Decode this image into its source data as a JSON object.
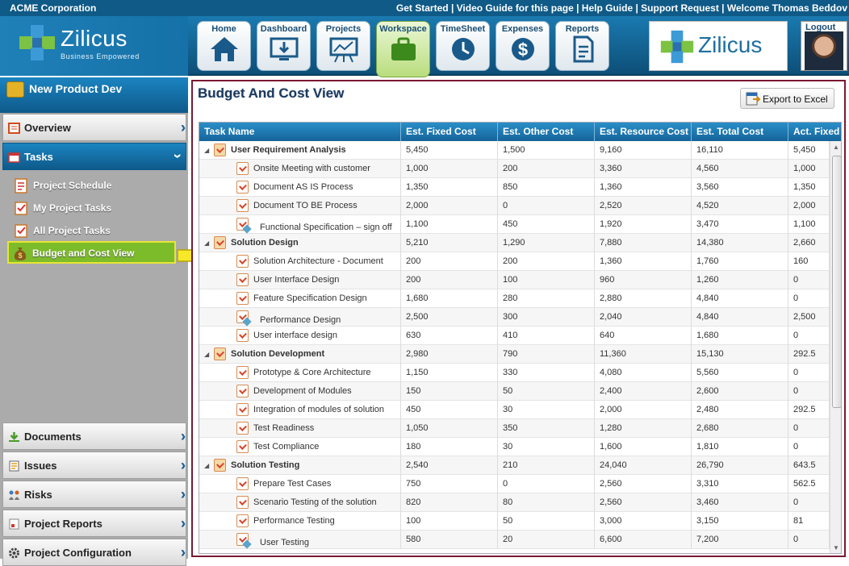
{
  "topbar": {
    "company": "ACME Corporation",
    "links": "Get Started | Video Guide for this page | Help Guide | Support Request | Welcome Thomas Beddov"
  },
  "logo": {
    "name": "Zilicus",
    "tagline": "Business Empowered"
  },
  "nav": [
    {
      "label": "Home",
      "icon": "home-icon"
    },
    {
      "label": "Dashboard",
      "icon": "dashboard-icon"
    },
    {
      "label": "Projects",
      "icon": "projects-icon"
    },
    {
      "label": "Workspace",
      "icon": "briefcase-icon",
      "active": true
    },
    {
      "label": "TimeSheet",
      "icon": "clock-icon"
    },
    {
      "label": "Expenses",
      "icon": "dollar-icon"
    },
    {
      "label": "Reports",
      "icon": "report-icon"
    }
  ],
  "brand": {
    "name": "Zilicus"
  },
  "logout": {
    "label": "Logout"
  },
  "sidebar": {
    "project": "New Product Dev",
    "overview": "Overview",
    "tasks": "Tasks",
    "sub_items": [
      "Project Schedule",
      "My Project Tasks",
      "All Project Tasks",
      "Budget and Cost View"
    ],
    "documents": "Documents",
    "issues": "Issues",
    "risks": "Risks",
    "reports": "Project Reports",
    "config": "Project Configuration"
  },
  "page": {
    "title": "Budget And Cost View",
    "export": "Export to Excel"
  },
  "grid": {
    "columns": [
      "Task Name",
      "Est. Fixed Cost",
      "Est. Other Cost",
      "Est. Resource Cost",
      "Est. Total Cost",
      "Act. Fixed Cost"
    ],
    "rows": [
      {
        "name": "User Requirement Analysis",
        "level": 0,
        "type": "group",
        "c": [
          "5,450",
          "1,500",
          "9,160",
          "16,110",
          "5,450"
        ]
      },
      {
        "name": "Onsite Meeting with customer",
        "level": 1,
        "type": "task",
        "c": [
          "1,000",
          "200",
          "3,360",
          "4,560",
          "1,000"
        ]
      },
      {
        "name": "Document AS IS Process",
        "level": 1,
        "type": "task",
        "c": [
          "1,350",
          "850",
          "1,360",
          "3,560",
          "1,350"
        ]
      },
      {
        "name": "Document TO BE Process",
        "level": 1,
        "type": "task",
        "c": [
          "2,000",
          "0",
          "2,520",
          "4,520",
          "2,000"
        ]
      },
      {
        "name": "Functional Specification – sign off",
        "level": 1,
        "type": "milestone",
        "c": [
          "1,100",
          "450",
          "1,920",
          "3,470",
          "1,100"
        ]
      },
      {
        "name": "Solution Design",
        "level": 0,
        "type": "group",
        "c": [
          "5,210",
          "1,290",
          "7,880",
          "14,380",
          "2,660"
        ]
      },
      {
        "name": "Solution Architecture - Document",
        "level": 1,
        "type": "task",
        "c": [
          "200",
          "200",
          "1,360",
          "1,760",
          "160"
        ]
      },
      {
        "name": "User Interface Design",
        "level": 1,
        "type": "task",
        "c": [
          "200",
          "100",
          "960",
          "1,260",
          "0"
        ]
      },
      {
        "name": "Feature Specification Design",
        "level": 1,
        "type": "task",
        "c": [
          "1,680",
          "280",
          "2,880",
          "4,840",
          "0"
        ]
      },
      {
        "name": "Performance Design",
        "level": 1,
        "type": "milestone",
        "c": [
          "2,500",
          "300",
          "2,040",
          "4,840",
          "2,500"
        ]
      },
      {
        "name": "User interface design",
        "level": 1,
        "type": "task",
        "c": [
          "630",
          "410",
          "640",
          "1,680",
          "0"
        ]
      },
      {
        "name": "Solution Development",
        "level": 0,
        "type": "group",
        "c": [
          "2,980",
          "790",
          "11,360",
          "15,130",
          "292.5"
        ]
      },
      {
        "name": "Prototype & Core Architecture",
        "level": 1,
        "type": "task",
        "c": [
          "1,150",
          "330",
          "4,080",
          "5,560",
          "0"
        ]
      },
      {
        "name": "Development of Modules",
        "level": 1,
        "type": "task",
        "c": [
          "150",
          "50",
          "2,400",
          "2,600",
          "0"
        ]
      },
      {
        "name": "Integration of modules of solution",
        "level": 1,
        "type": "task",
        "c": [
          "450",
          "30",
          "2,000",
          "2,480",
          "292.5"
        ]
      },
      {
        "name": "Test Readiness",
        "level": 1,
        "type": "task",
        "c": [
          "1,050",
          "350",
          "1,280",
          "2,680",
          "0"
        ]
      },
      {
        "name": "Test Compliance",
        "level": 1,
        "type": "task",
        "c": [
          "180",
          "30",
          "1,600",
          "1,810",
          "0"
        ]
      },
      {
        "name": "Solution Testing",
        "level": 0,
        "type": "group",
        "c": [
          "2,540",
          "210",
          "24,040",
          "26,790",
          "643.5"
        ]
      },
      {
        "name": "Prepare Test Cases",
        "level": 1,
        "type": "task",
        "c": [
          "750",
          "0",
          "2,560",
          "3,310",
          "562.5"
        ]
      },
      {
        "name": "Scenario Testing of the solution",
        "level": 1,
        "type": "task",
        "c": [
          "820",
          "80",
          "2,560",
          "3,460",
          "0"
        ]
      },
      {
        "name": "Performance Testing",
        "level": 1,
        "type": "task",
        "c": [
          "100",
          "50",
          "3,000",
          "3,150",
          "81"
        ]
      },
      {
        "name": "User Testing",
        "level": 1,
        "type": "milestone",
        "c": [
          "580",
          "20",
          "6,600",
          "7,200",
          "0"
        ]
      }
    ]
  }
}
